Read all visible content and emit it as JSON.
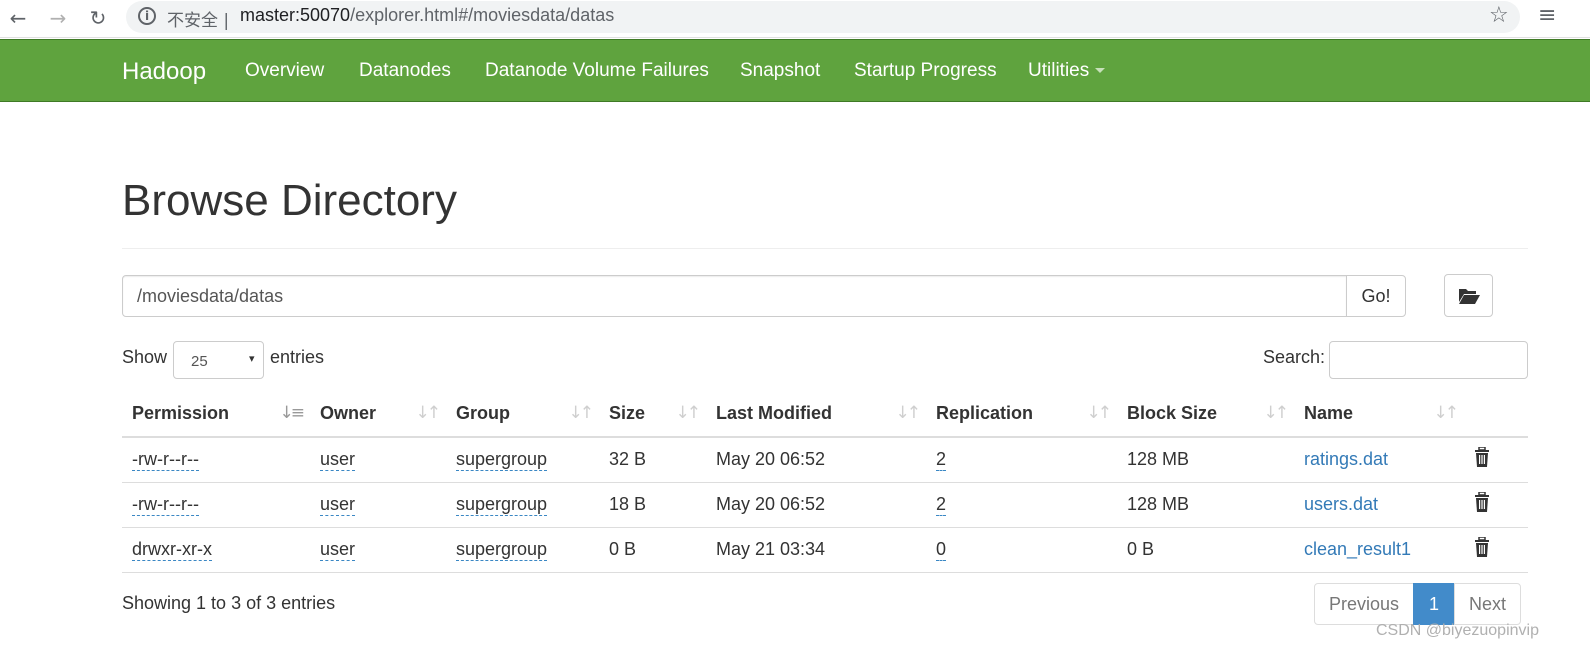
{
  "browser": {
    "security_label": "不安全",
    "url_host": "master:50070",
    "url_path": "/explorer.html#/moviesdata/datas"
  },
  "navbar": {
    "brand": "Hadoop",
    "items": [
      "Overview",
      "Datanodes",
      "Datanode Volume Failures",
      "Snapshot",
      "Startup Progress",
      "Utilities"
    ]
  },
  "page": {
    "title": "Browse Directory",
    "path_value": "/moviesdata/datas",
    "go_label": "Go!",
    "show_label": "Show",
    "entries_value": "25",
    "entries_label": "entries",
    "search_label": "Search:",
    "search_value": ""
  },
  "table": {
    "columns": [
      "Permission",
      "Owner",
      "Group",
      "Size",
      "Last Modified",
      "Replication",
      "Block Size",
      "Name"
    ],
    "rows": [
      {
        "permission": "-rw-r--r--",
        "owner": "user",
        "group": "supergroup",
        "size": "32 B",
        "modified": "May 20 06:52",
        "replication": "2",
        "block_size": "128 MB",
        "name": "ratings.dat"
      },
      {
        "permission": "-rw-r--r--",
        "owner": "user",
        "group": "supergroup",
        "size": "18 B",
        "modified": "May 20 06:52",
        "replication": "2",
        "block_size": "128 MB",
        "name": "users.dat"
      },
      {
        "permission": "drwxr-xr-x",
        "owner": "user",
        "group": "supergroup",
        "size": "0 B",
        "modified": "May 21 03:34",
        "replication": "0",
        "block_size": "0 B",
        "name": "clean_result1"
      }
    ]
  },
  "footer": {
    "showing": "Showing 1 to 3 of 3 entries",
    "previous": "Previous",
    "current_page": "1",
    "next": "Next"
  },
  "watermark": "CSDN @biyezuopinvip",
  "colors": {
    "navbar": "#5fa33e",
    "link": "#337ab7",
    "active_page": "#428bca"
  }
}
